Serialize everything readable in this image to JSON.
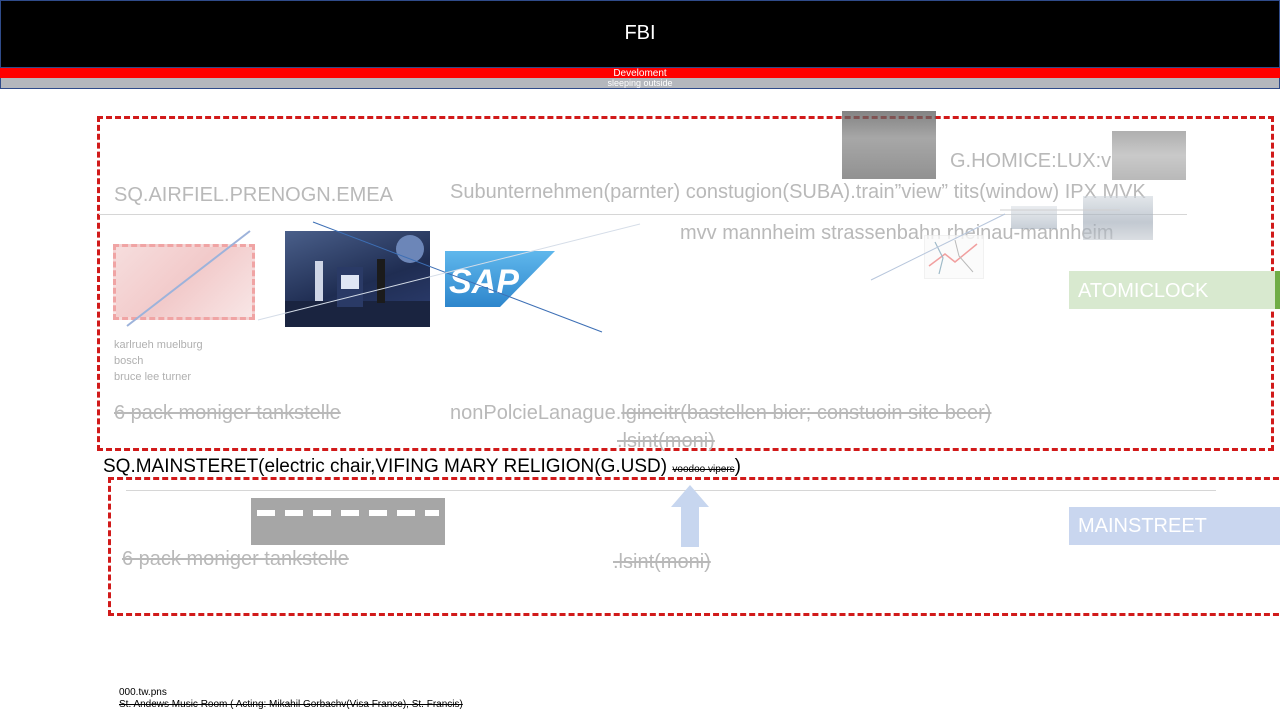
{
  "header": {
    "title": "FBI",
    "red_bar_text": "Develoment",
    "grey_bar_text": "sleeping outside"
  },
  "box1": {
    "label_left": "SQ.AIRFIEL.PRENOGN.EMEA",
    "label_center": "Subunternehmen(parnter) constugion(SUBA).train”view”  tits(window) IPX MVK",
    "label_homice": "G.HOMICE:LUX:v",
    "label_mvv": "mvv mannheim strassenbahn rheinau-mannheim",
    "list": [
      "karlrueh muelburg",
      "bosch",
      "bruce lee turner"
    ],
    "sixpack": "6 pack moniger tankstelle",
    "nonpolice": "nonPolcieLanague.",
    "nonpolice_strike": "lgineitr(bastellen bier; constuoin site beer)",
    "lsint": ".lsint(moni)",
    "atomic_label": "ATOMICLOCK",
    "sap_logo": "SAP"
  },
  "main_line": {
    "text": "SQ.MAINSTERET(electric chair,VIFING MARY RELIGION(G.USD)",
    "small": "voodoo vipers",
    "close": ")"
  },
  "box2": {
    "sixpack": "6 pack moniger tankstelle",
    "lsint": ".lsint(moni)",
    "mainstreet_label": "MAINSTREET"
  },
  "footer": {
    "line1": "000.tw.pns",
    "line2": "St. Andews Music Room ( Acting: Mikahil Gorbachv(Visa France), St. Francis)"
  },
  "colors": {
    "dash_red": "#d11a1a",
    "header_red": "#ff0000",
    "atomic_green": "#d8e9cf",
    "mainstreet_blue": "#c9d6ef"
  }
}
